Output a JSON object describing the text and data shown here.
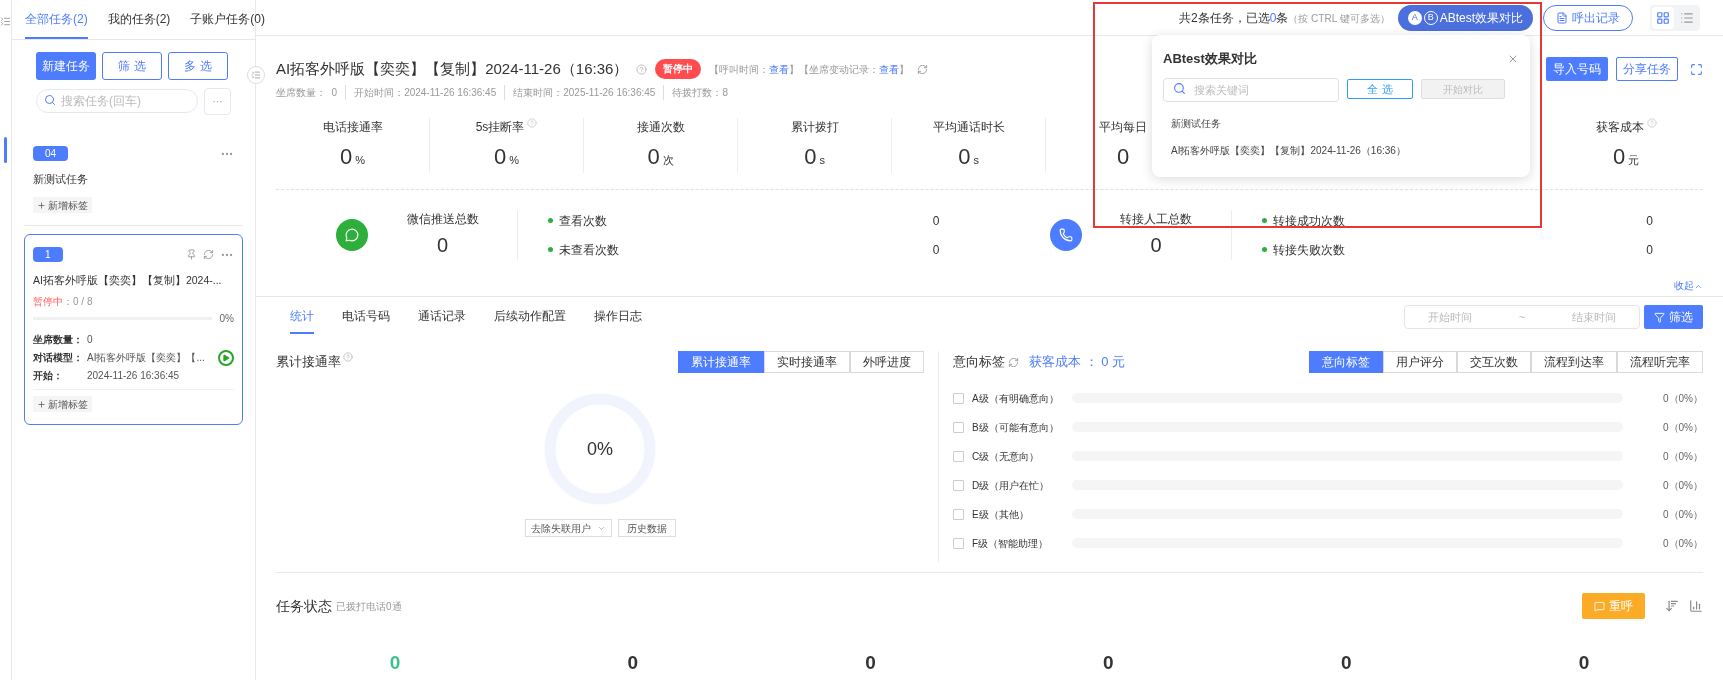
{
  "top_tabs": [
    {
      "label": "全部任务(2)",
      "selected": true
    },
    {
      "label": "我的任务(2)",
      "selected": false
    },
    {
      "label": "子账户任务(0)",
      "selected": false
    }
  ],
  "summary": {
    "prefix": "共2条任务，已选",
    "count": "0",
    "suffix": "条",
    "hint": "（按 CTRL 键可多选）"
  },
  "abtest_button": {
    "badge_a": "A",
    "badge_b": "B",
    "label": "ABtest效果对比"
  },
  "outbound_button": "呼出记录",
  "view_toggle": [
    {
      "kind": "grid",
      "selected": true
    },
    {
      "kind": "list",
      "selected": false
    }
  ],
  "sidebar": {
    "buttons": [
      {
        "label": "新建任务",
        "kind": "primary"
      },
      {
        "label": "筛 选",
        "kind": "outline"
      },
      {
        "label": "多 选",
        "kind": "outline"
      }
    ],
    "search": {
      "placeholder": "搜索任务(回车)"
    },
    "more": "···",
    "tasks": [
      {
        "badge": "04",
        "title": "新测试任务",
        "selected": false,
        "tag_button": "新增标签"
      },
      {
        "badge": "1",
        "title": "AI拓客外呼版【奕奕】【复制】2024-...",
        "selected": true,
        "status": "暂停中",
        "progress": "：0 / 8",
        "level": 0,
        "percent": "0%",
        "fields": [
          {
            "label": "坐席数量：",
            "value": "0"
          },
          {
            "label": "对话模型：",
            "value": "AI拓客外呼版【奕奕】【..."
          },
          {
            "label": "开始：",
            "value": "2024-11-26 16:36:45"
          }
        ],
        "tag_button": "新增标签"
      }
    ]
  },
  "task_header": {
    "title": "AI拓客外呼版【奕奕】【复制】2024-11-26（16:36）",
    "status": "暂停中",
    "links": [
      {
        "label": "【呼叫时间：",
        "link": "查看",
        "end": "】"
      },
      {
        "label": "【坐席变动记录：",
        "link": "查看",
        "end": "】"
      }
    ],
    "meta": [
      "坐席数量：  0",
      "开始时间：2024-11-26 16:36:45",
      "结束时间：2025-11-26 16:36:45",
      "待拨打数：8"
    ],
    "buttons": [
      {
        "label": "导入号码",
        "kind": "primary"
      },
      {
        "label": "分享任务",
        "kind": "outline"
      }
    ]
  },
  "stats": [
    {
      "label": "电话接通率",
      "value": "0",
      "unit": "%",
      "help": false
    },
    {
      "label": "5s挂断率",
      "value": "0",
      "unit": "%",
      "help": true
    },
    {
      "label": "接通次数",
      "value": "0",
      "unit": "次",
      "help": false
    },
    {
      "label": "累计拨打",
      "value": "0",
      "unit": "s",
      "help": false
    },
    {
      "label": "平均通话时长",
      "value": "0",
      "unit": "s",
      "help": false
    },
    {
      "label": "平均每日",
      "value": "0",
      "help": false
    },
    {
      "label": "获客成本",
      "value": "0",
      "unit": "元",
      "help": true
    }
  ],
  "push_stats": [
    {
      "kind": "wechat",
      "title": "微信推送总数",
      "value": "0",
      "items": [
        {
          "label": "查看次数",
          "value": "0"
        },
        {
          "label": "未查看次数",
          "value": "0"
        }
      ]
    },
    {
      "kind": "transfer",
      "title": "转接人工总数",
      "value": "0",
      "items": [
        {
          "label": "转接成功次数",
          "value": "0"
        },
        {
          "label": "转接失败次数",
          "value": "0"
        }
      ]
    }
  ],
  "collapse": "收起",
  "sub_tabs": [
    {
      "label": "统计",
      "selected": true
    },
    {
      "label": "电话号码",
      "selected": false
    },
    {
      "label": "通话记录",
      "selected": false
    },
    {
      "label": "后续动作配置",
      "selected": false
    },
    {
      "label": "操作日志",
      "selected": false
    }
  ],
  "date_range": {
    "start": "开始时间",
    "separator": "~",
    "end": "结束时间",
    "filter": "筛选"
  },
  "connect_card": {
    "title": "累计接通率",
    "segments": [
      {
        "label": "累计接通率",
        "selected": true
      },
      {
        "label": "实时接通率",
        "selected": false
      },
      {
        "label": "外呼进度",
        "selected": false
      }
    ],
    "percent": "0%",
    "level": 0,
    "select": "去除失联用户",
    "history": "历史数据"
  },
  "intent_card": {
    "title": "意向标签",
    "cost": "获客成本 ： 0 元",
    "segments": [
      {
        "label": "意向标签",
        "selected": true
      },
      {
        "label": "用户评分",
        "selected": false
      },
      {
        "label": "交互次数",
        "selected": false
      },
      {
        "label": "流程到达率",
        "selected": false
      },
      {
        "label": "流程听完率",
        "selected": false
      }
    ],
    "rows": [
      {
        "label": "A级（有明确意向）",
        "checked": false,
        "level": 0,
        "value": "0（0%）"
      },
      {
        "label": "B级（可能有意向）",
        "checked": false,
        "level": 0,
        "value": "0（0%）"
      },
      {
        "label": "C级（无意向）",
        "checked": false,
        "level": 0,
        "value": "0（0%）"
      },
      {
        "label": "D级（用户在忙）",
        "checked": false,
        "level": 0,
        "value": "0（0%）"
      },
      {
        "label": "E级（其他）",
        "checked": false,
        "level": 0,
        "value": "0（0%）"
      },
      {
        "label": "F级（智能助理）",
        "checked": false,
        "level": 0,
        "value": "0（0%）"
      }
    ]
  },
  "task_status": {
    "title": "任务状态",
    "subtitle": "已拨打电话0通",
    "redial": "重呼",
    "counts": [
      {
        "value": "0",
        "color": "#3cc18b"
      },
      {
        "value": "0",
        "color": "#333333"
      },
      {
        "value": "0",
        "color": "#333333"
      },
      {
        "value": "0",
        "color": "#333333"
      },
      {
        "value": "0",
        "color": "#333333"
      },
      {
        "value": "0",
        "color": "#333333"
      }
    ]
  },
  "popup": {
    "title": "ABtest效果对比",
    "search": {
      "placeholder": "搜索关键词"
    },
    "select_all": "全 选",
    "compare": {
      "label": "开始对比",
      "disabled": true
    },
    "items": [
      "新测试任务",
      "AI拓客外呼版【奕奕】【复制】2024-11-26（16:36）"
    ]
  },
  "highlight": true
}
